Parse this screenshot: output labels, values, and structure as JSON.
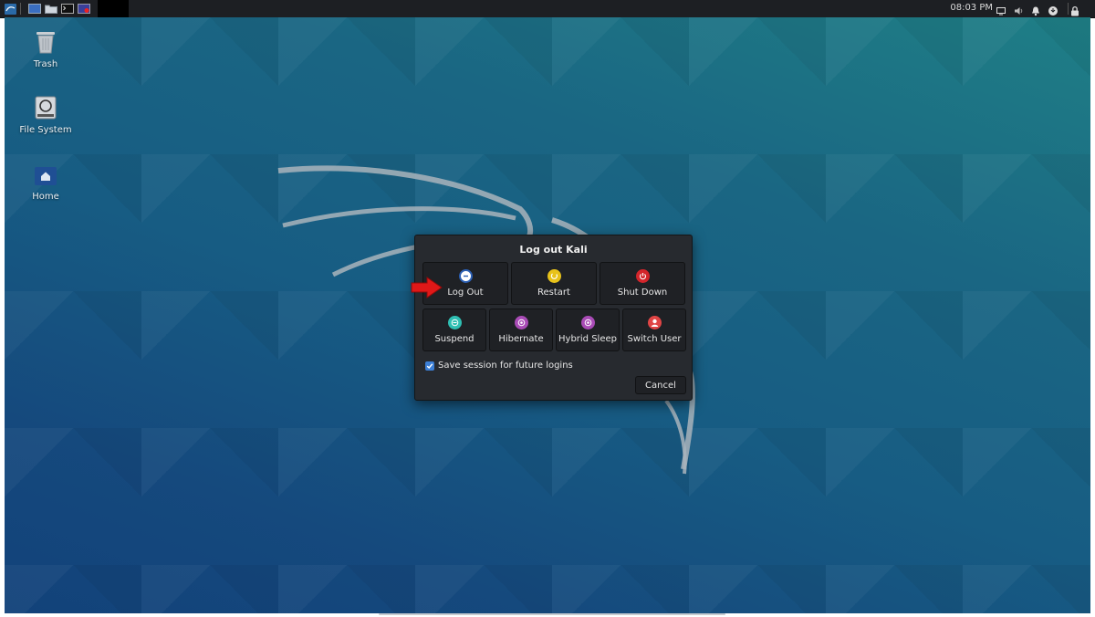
{
  "topbar": {
    "clock": "08:03 PM",
    "launchers": [
      "kali-menu-icon",
      "desktop-icon",
      "file-manager-icon",
      "terminal-icon",
      "screen-recorder-icon"
    ],
    "tray_icons": [
      "display-icon",
      "volume-icon",
      "bell-icon",
      "power-manager-icon",
      "lock-icon"
    ]
  },
  "desktop": {
    "icons": [
      {
        "label": "Trash",
        "icon": "trash-icon"
      },
      {
        "label": "File System",
        "icon": "drive-icon"
      },
      {
        "label": "Home",
        "icon": "home-folder-icon"
      }
    ]
  },
  "dialog": {
    "title": "Log out Kali",
    "actions": {
      "logout": "Log Out",
      "restart": "Restart",
      "shutdown": "Shut Down",
      "suspend": "Suspend",
      "hibernate": "Hibernate",
      "hybrid_sleep": "Hybrid Sleep",
      "switch_user": "Switch User"
    },
    "save_session": {
      "label": "Save session for future logins",
      "checked": true
    },
    "cancel": "Cancel"
  },
  "colors": {
    "logout": "#2b5fb3",
    "restart": "#e8c21a",
    "shutdown": "#d3252b",
    "suspend": "#2fbfb3",
    "hibernate": "#a94bb6",
    "switch_user": "#e04545",
    "accent": "#3c7fd6",
    "pointer_arrow": "#e01818"
  }
}
